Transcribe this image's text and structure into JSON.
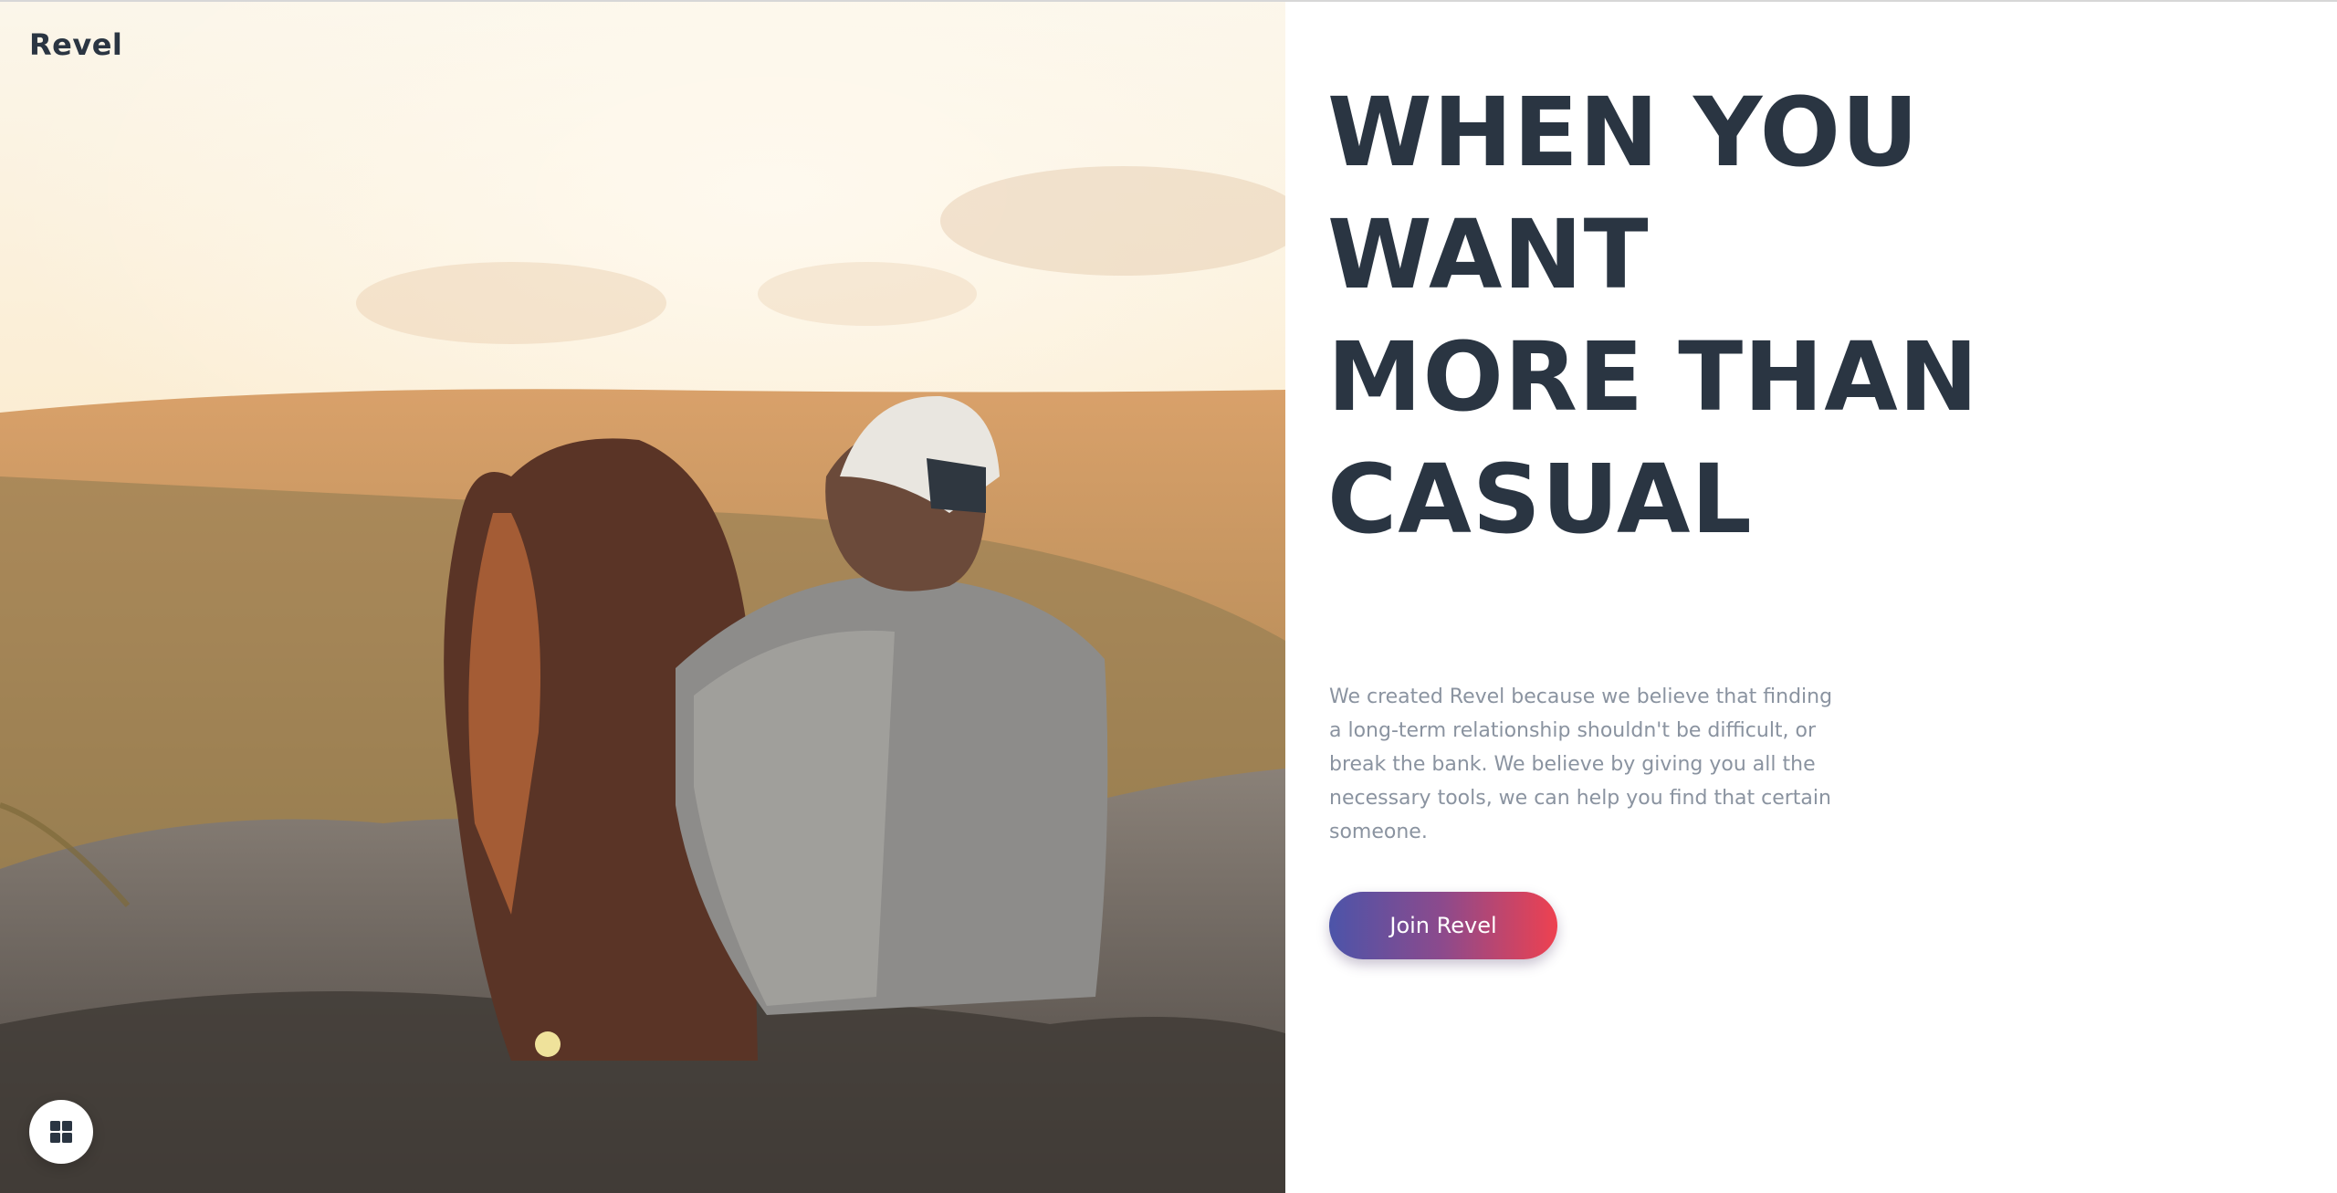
{
  "brand": {
    "name": "Revel"
  },
  "hero": {
    "headline_lines": [
      "WHEN YOU",
      "WANT",
      "MORE THAN",
      "CASUAL"
    ],
    "description": "We created Revel because we believe that finding a long-term relationship shouldn't be difficult, or break the bank. We believe by giving you all the necessary tools, we can help you find that certain someone.",
    "cta_label": "Join Revel",
    "image_subject": "couple sitting on rocks at sunset, mountain view"
  },
  "floating_button": {
    "icon": "grid-icon"
  },
  "colors": {
    "heading": "#2a3542",
    "body_text": "#8a93a0",
    "cta_gradient_start": "#4c54a9",
    "cta_gradient_end": "#ee4150",
    "background": "#ffffff"
  }
}
